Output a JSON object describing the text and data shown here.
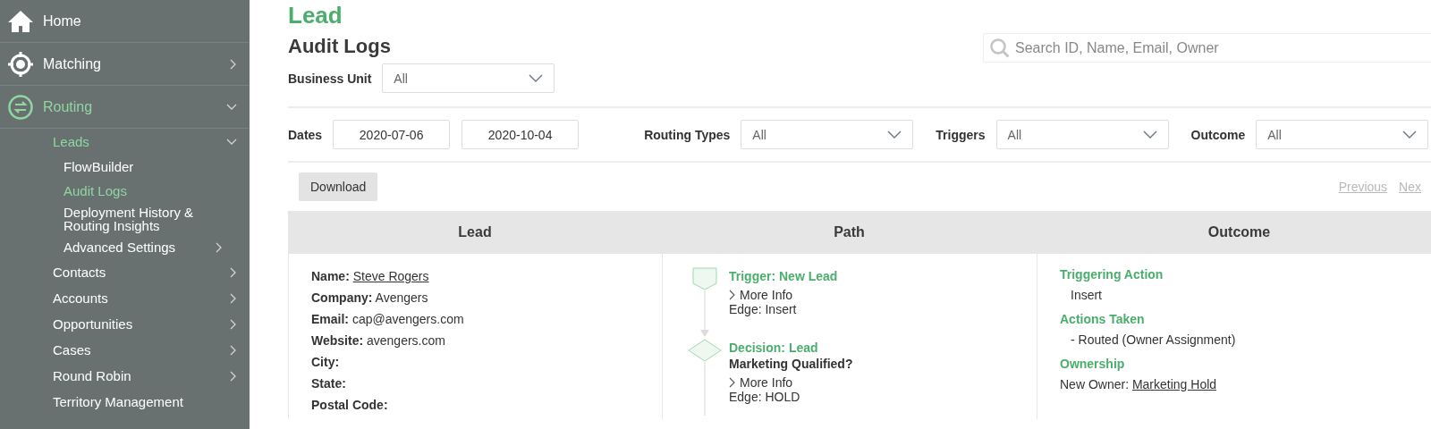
{
  "sidebar": {
    "items": [
      {
        "label": "Home",
        "selected": false
      },
      {
        "label": "Matching",
        "selected": false,
        "expanded": false
      },
      {
        "label": "Routing",
        "selected": true,
        "expanded": true,
        "children": [
          {
            "label": "Leads",
            "selected": true,
            "expanded": true,
            "children": [
              {
                "label": "FlowBuilder",
                "selected": false
              },
              {
                "label": "Audit Logs",
                "selected": true
              },
              {
                "label": "Deployment History & Routing Insights",
                "selected": false
              },
              {
                "label": "Advanced Settings",
                "selected": false,
                "expanded": false
              }
            ]
          },
          {
            "label": "Contacts",
            "selected": false,
            "expanded": false
          },
          {
            "label": "Accounts",
            "selected": false,
            "expanded": false
          },
          {
            "label": "Opportunities",
            "selected": false,
            "expanded": false
          },
          {
            "label": "Cases",
            "selected": false,
            "expanded": false
          },
          {
            "label": "Round Robin",
            "selected": false,
            "expanded": false
          },
          {
            "label": "Territory Management",
            "selected": false
          }
        ]
      }
    ]
  },
  "header": {
    "object": "Lead",
    "title": "Audit Logs"
  },
  "search": {
    "placeholder": "Search ID, Name, Email, Owner"
  },
  "business_unit": {
    "label": "Business Unit",
    "value": "All"
  },
  "dates": {
    "label": "Dates",
    "from": "2020-07-06",
    "to": "2020-10-04"
  },
  "filters": [
    {
      "label": "Routing Types",
      "value": "All"
    },
    {
      "label": "Triggers",
      "value": "All"
    },
    {
      "label": "Outcome",
      "value": "All"
    }
  ],
  "download_button": "Download",
  "pager": [
    {
      "label": "Previous",
      "disabled": true
    },
    {
      "label": "Nex",
      "disabled": true
    }
  ],
  "table": {
    "columns": [
      "Lead",
      "Path",
      "Outcome"
    ],
    "lead_fields": [
      {
        "label": "Name:",
        "value": "Steve Rogers",
        "link": true
      },
      {
        "label": "Company:",
        "value": "Avengers",
        "link": false
      },
      {
        "label": "Email:",
        "value": "cap@avengers.com",
        "link": false
      },
      {
        "label": "Website:",
        "value": "avengers.com",
        "link": false
      },
      {
        "label": "City:"
      },
      {
        "label": "State:"
      },
      {
        "label": "Postal Code:"
      }
    ],
    "path_steps": [
      {
        "kind": "trigger",
        "title": "Trigger: New Lead",
        "more_info": "More Info",
        "edge": "Edge: Insert"
      },
      {
        "kind": "decision",
        "title": "Decision: Lead",
        "subtitle": "Marketing Qualified?",
        "more_info": "More Info",
        "edge": "Edge: HOLD"
      }
    ],
    "outcome": [
      {
        "heading": "Triggering Action",
        "text": "Insert",
        "indented": true
      },
      {
        "heading": "Actions Taken",
        "text": "- Routed (Owner Assignment)",
        "indented": true
      },
      {
        "heading": "Ownership",
        "prefix": "New Owner:",
        "link": "Marketing Hold",
        "indented": false
      }
    ]
  }
}
